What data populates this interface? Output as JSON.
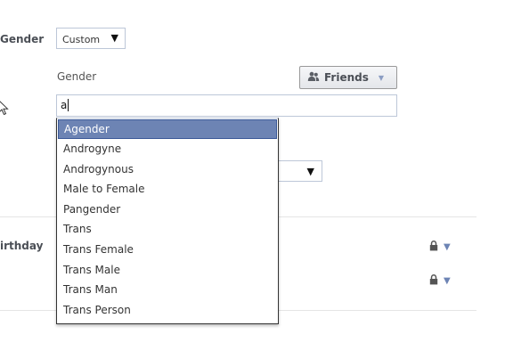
{
  "gender_row": {
    "label": "Gender",
    "select_value": "Custom",
    "select_arrow": "▼"
  },
  "custom_gender": {
    "sublabel": "Gender",
    "privacy_label": "Friends",
    "privacy_icon": "friends-icon",
    "privacy_caret": "▼",
    "input_value": "a",
    "hidden_select_arrow": "▼"
  },
  "birthday_row": {
    "label": "irthday",
    "lock_icon": "lock-icon",
    "caret": "▼"
  },
  "dropdown": {
    "items": [
      "Agender",
      "Androgyne",
      "Androgynous",
      "Male to Female",
      "Pangender",
      "Trans",
      "Trans Female",
      "Trans Male",
      "Trans Man",
      "Trans Person"
    ],
    "highlighted_index": 0
  },
  "colors": {
    "highlight": "#6d84b4",
    "border": "#bdc7d8",
    "caret": "#6d84b4"
  }
}
